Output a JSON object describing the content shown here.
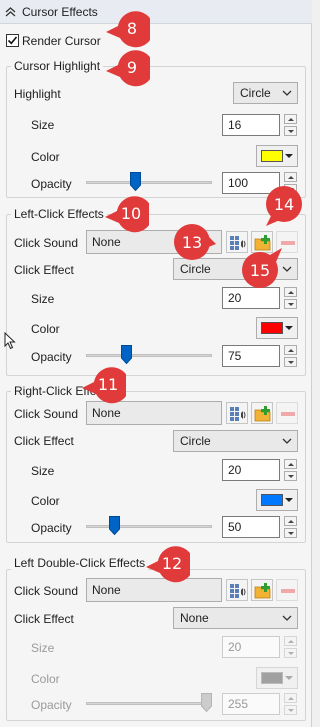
{
  "panel": {
    "title": "Cursor Effects"
  },
  "render_cursor": {
    "label": "Render Cursor",
    "checked": true
  },
  "cursor_highlight": {
    "title": "Cursor Highlight",
    "highlight_label": "Highlight",
    "highlight_value": "Circle",
    "size_label": "Size",
    "size_value": "16",
    "color_label": "Color",
    "color": "#ffff00",
    "opacity_label": "Opacity",
    "opacity_value": "100",
    "opacity_fraction": 0.38
  },
  "left_click": {
    "title": "Left-Click Effects",
    "sound_label": "Click Sound",
    "sound_value": "None",
    "effect_label": "Click Effect",
    "effect_value": "Circle",
    "size_label": "Size",
    "size_value": "20",
    "color_label": "Color",
    "color": "#ff0000",
    "opacity_label": "Opacity",
    "opacity_value": "75",
    "opacity_fraction": 0.3
  },
  "right_click": {
    "title": "Right-Click Effects",
    "sound_label": "Click Sound",
    "sound_value": "None",
    "effect_label": "Click Effect",
    "effect_value": "Circle",
    "size_label": "Size",
    "size_value": "20",
    "color_label": "Color",
    "color": "#0078ff",
    "opacity_label": "Opacity",
    "opacity_value": "50",
    "opacity_fraction": 0.2
  },
  "left_double_click": {
    "title": "Left Double-Click Effects",
    "sound_label": "Click Sound",
    "sound_value": "None",
    "effect_label": "Click Effect",
    "effect_value": "None",
    "size_label": "Size",
    "size_value": "20",
    "color_label": "Color",
    "color": "#a0a0a0",
    "opacity_label": "Opacity",
    "opacity_value": "255",
    "opacity_fraction": 1.0
  },
  "callouts": [
    "8",
    "9",
    "10",
    "11",
    "12",
    "13",
    "14",
    "15"
  ],
  "colors": {
    "callout": "#e03a3a",
    "panel_header": "#e8ecf2"
  },
  "icons": [
    "chevron-up-icon",
    "checkmark-icon",
    "speaker-grid-icon",
    "folder-add-icon",
    "remove-icon",
    "cursor-arrow-icon"
  ]
}
